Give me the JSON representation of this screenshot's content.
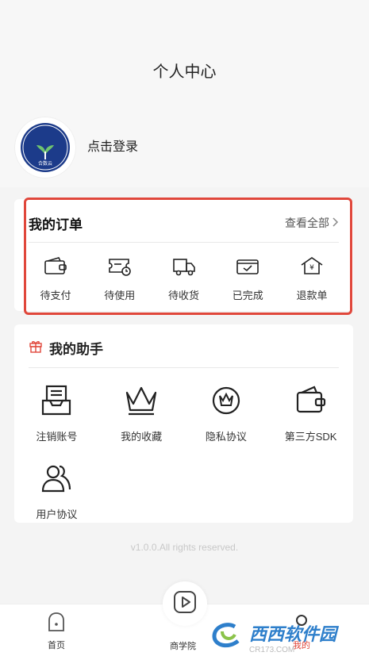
{
  "header": {
    "title": "个人中心"
  },
  "profile": {
    "login_label": "点击登录",
    "avatar_text": "合数云"
  },
  "orders": {
    "title": "我的订单",
    "view_all": "查看全部",
    "items": [
      {
        "label": "待支付",
        "icon": "wallet-icon"
      },
      {
        "label": "待使用",
        "icon": "ticket-clock-icon"
      },
      {
        "label": "待收货",
        "icon": "truck-icon"
      },
      {
        "label": "已完成",
        "icon": "check-box-icon"
      },
      {
        "label": "退款单",
        "icon": "refund-house-icon"
      }
    ]
  },
  "helper": {
    "title": "我的助手",
    "items": [
      {
        "label": "注销账号",
        "icon": "inbox-icon"
      },
      {
        "label": "我的收藏",
        "icon": "crown-icon"
      },
      {
        "label": "隐私协议",
        "icon": "privacy-crown-icon"
      },
      {
        "label": "第三方SDK",
        "icon": "wallet-icon"
      },
      {
        "label": "用户协议",
        "icon": "users-icon"
      }
    ]
  },
  "footer": {
    "version": "v1.0.0.All rights reserved."
  },
  "tabbar": {
    "items": [
      {
        "label": "首页",
        "icon": "home-icon"
      },
      {
        "label": "商学院",
        "icon": "play-icon"
      },
      {
        "label": "我的",
        "icon": "user-icon"
      }
    ]
  },
  "watermark": {
    "brand": "西西软件园",
    "url": "CR173.COM"
  },
  "colors": {
    "highlight": "#e0473b",
    "watermark": "#2e7fcb",
    "avatar_bg": "#1c3b8a"
  }
}
